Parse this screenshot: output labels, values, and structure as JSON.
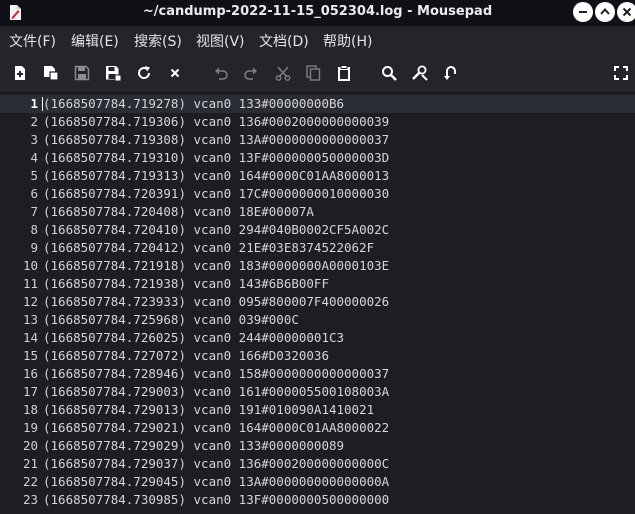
{
  "window": {
    "title": "~/candump-2022-11-15_052304.log - Mousepad"
  },
  "icons": {
    "app": "mousepad-icon",
    "minimize": "minimize-icon",
    "maximize": "maximize-icon",
    "close": "close-icon"
  },
  "menu": {
    "items": [
      {
        "label": "文件(F)"
      },
      {
        "label": "编辑(E)"
      },
      {
        "label": "搜索(S)"
      },
      {
        "label": "视图(V)"
      },
      {
        "label": "文档(D)"
      },
      {
        "label": "帮助(H)"
      }
    ]
  },
  "toolbar": {
    "buttons": [
      {
        "name": "new-document-icon"
      },
      {
        "name": "new-window-icon"
      },
      {
        "name": "save-icon"
      },
      {
        "name": "save-as-icon"
      },
      {
        "name": "reload-icon"
      },
      {
        "name": "close-document-icon"
      },
      {
        "name": "undo-icon"
      },
      {
        "name": "redo-icon"
      },
      {
        "name": "cut-icon"
      },
      {
        "name": "copy-icon"
      },
      {
        "name": "paste-icon"
      },
      {
        "name": "find-icon"
      },
      {
        "name": "find-replace-icon"
      },
      {
        "name": "goto-line-icon"
      },
      {
        "name": "fullscreen-icon"
      }
    ]
  },
  "editor": {
    "current_line": 1,
    "lines": [
      {
        "n": "1",
        "text": "(1668507784.719278) vcan0 133#00000000B6"
      },
      {
        "n": "2",
        "text": "(1668507784.719306) vcan0 136#0002000000000039"
      },
      {
        "n": "3",
        "text": "(1668507784.719308) vcan0 13A#0000000000000037"
      },
      {
        "n": "4",
        "text": "(1668507784.719310) vcan0 13F#000000050000003D"
      },
      {
        "n": "5",
        "text": "(1668507784.719313) vcan0 164#0000C01AA8000013"
      },
      {
        "n": "6",
        "text": "(1668507784.720391) vcan0 17C#0000000010000030"
      },
      {
        "n": "7",
        "text": "(1668507784.720408) vcan0 18E#00007A"
      },
      {
        "n": "8",
        "text": "(1668507784.720410) vcan0 294#040B0002CF5A002C"
      },
      {
        "n": "9",
        "text": "(1668507784.720412) vcan0 21E#03E8374522062F"
      },
      {
        "n": "10",
        "text": "(1668507784.721918) vcan0 183#0000000A0000103E"
      },
      {
        "n": "11",
        "text": "(1668507784.721938) vcan0 143#6B6B00FF"
      },
      {
        "n": "12",
        "text": "(1668507784.723933) vcan0 095#800007F400000026"
      },
      {
        "n": "13",
        "text": "(1668507784.725968) vcan0 039#000C"
      },
      {
        "n": "14",
        "text": "(1668507784.726025) vcan0 244#00000001C3"
      },
      {
        "n": "15",
        "text": "(1668507784.727072) vcan0 166#D0320036"
      },
      {
        "n": "16",
        "text": "(1668507784.728946) vcan0 158#0000000000000037"
      },
      {
        "n": "17",
        "text": "(1668507784.729003) vcan0 161#000005500108003A"
      },
      {
        "n": "18",
        "text": "(1668507784.729013) vcan0 191#010090A1410021"
      },
      {
        "n": "19",
        "text": "(1668507784.729021) vcan0 164#0000C01AA8000022"
      },
      {
        "n": "20",
        "text": "(1668507784.729029) vcan0 133#0000000089"
      },
      {
        "n": "21",
        "text": "(1668507784.729037) vcan0 136#000200000000000C"
      },
      {
        "n": "22",
        "text": "(1668507784.729045) vcan0 13A#000000000000000A"
      },
      {
        "n": "23",
        "text": "(1668507784.730985) vcan0 13F#0000000500000000"
      }
    ]
  },
  "colors": {
    "background": "#1c1e23",
    "titlebar": "#101116",
    "menubar": "#23252b",
    "text": "#d6d6d6",
    "current_line": "#2a2d34"
  }
}
